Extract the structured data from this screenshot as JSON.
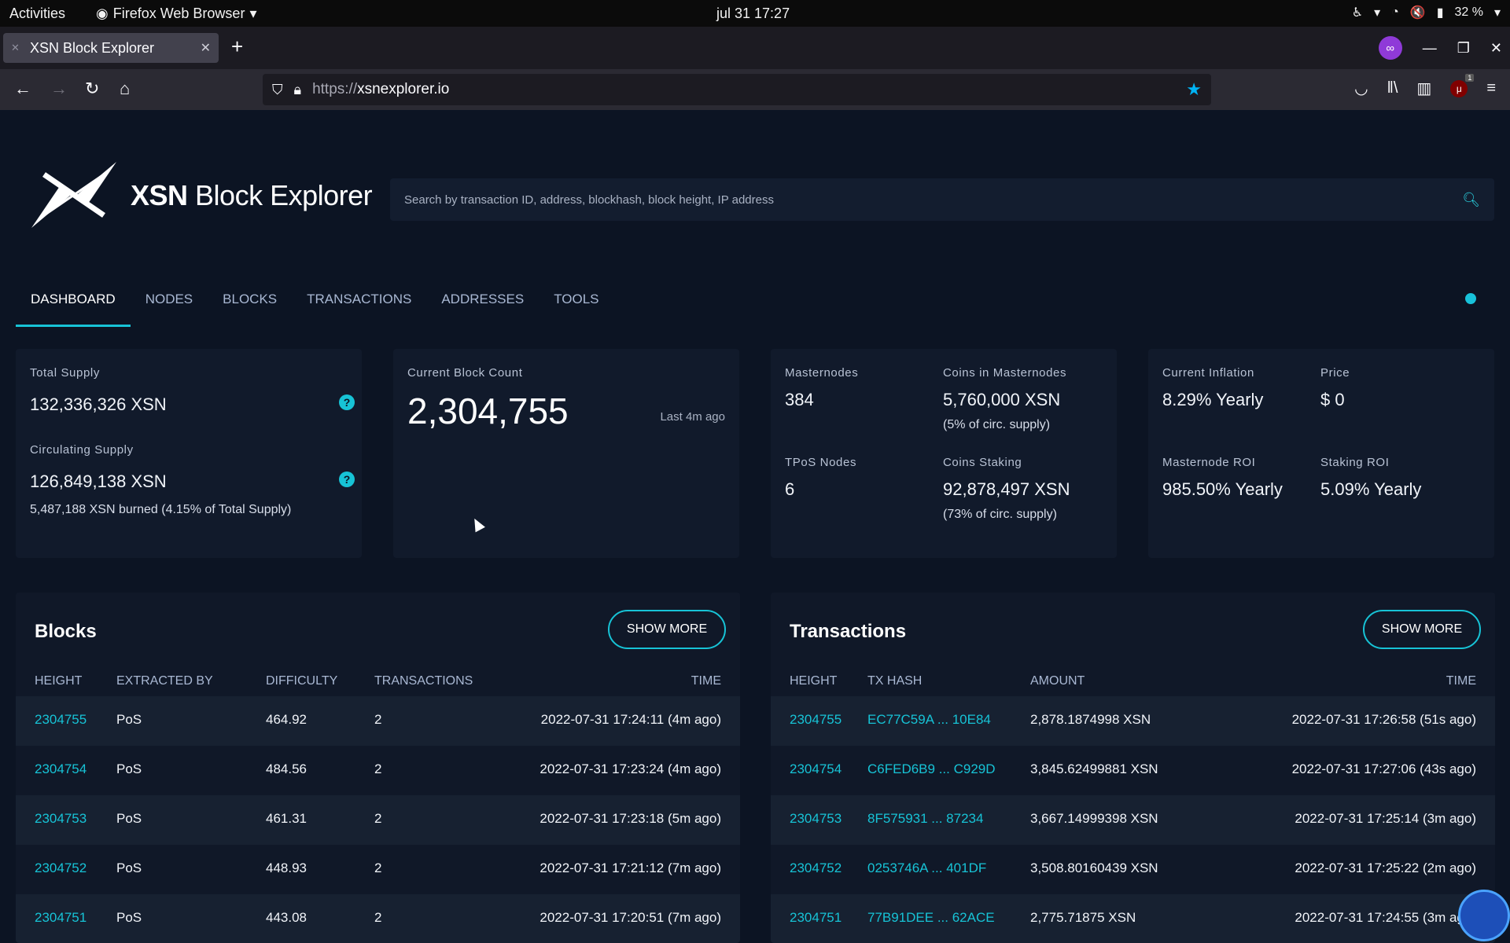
{
  "system": {
    "activities": "Activities",
    "app_name": "Firefox Web Browser",
    "clock": "jul 31  17:27",
    "battery": "32 %"
  },
  "browser": {
    "tab_title": "XSN Block Explorer",
    "url_scheme": "https://",
    "url_host": "xsnexplorer.io",
    "ublock_count": "1"
  },
  "site": {
    "brand_bold": "XSN",
    "brand_rest": " Block Explorer",
    "search_placeholder": "Search by transaction ID, address, blockhash, block height, IP address"
  },
  "nav": {
    "items": [
      "DASHBOARD",
      "NODES",
      "BLOCKS",
      "TRANSACTIONS",
      "ADDRESSES",
      "TOOLS"
    ],
    "active": "DASHBOARD"
  },
  "stats": {
    "total_supply_label": "Total Supply",
    "total_supply": "132,336,326 XSN",
    "circulating_supply_label": "Circulating Supply",
    "circulating_supply": "126,849,138 XSN",
    "burned_note": "5,487,188 XSN burned (4.15% of Total Supply)",
    "block_count_label": "Current Block Count",
    "block_count": "2,304,755",
    "block_count_age": "Last 4m ago",
    "masternodes_label": "Masternodes",
    "masternodes": "384",
    "coins_in_masternodes_label": "Coins in Masternodes",
    "coins_in_masternodes": "5,760,000 XSN",
    "coins_in_masternodes_pct": "(5% of circ. supply)",
    "tpos_label": "TPoS Nodes",
    "tpos": "6",
    "coins_staking_label": "Coins Staking",
    "coins_staking": "92,878,497 XSN",
    "coins_staking_pct": "(73% of circ. supply)",
    "inflation_label": "Current Inflation",
    "inflation": "8.29% Yearly",
    "price_label": "Price",
    "price": "$ 0",
    "mn_roi_label": "Masternode ROI",
    "mn_roi": "985.50% Yearly",
    "staking_roi_label": "Staking ROI",
    "staking_roi": "5.09% Yearly"
  },
  "blocks": {
    "title": "Blocks",
    "show_more": "SHOW MORE",
    "headers": [
      "HEIGHT",
      "EXTRACTED BY",
      "DIFFICULTY",
      "TRANSACTIONS",
      "TIME"
    ],
    "rows": [
      {
        "height": "2304755",
        "by": "PoS",
        "difficulty": "464.92",
        "txs": "2",
        "time": "2022-07-31 17:24:11 (4m ago)"
      },
      {
        "height": "2304754",
        "by": "PoS",
        "difficulty": "484.56",
        "txs": "2",
        "time": "2022-07-31 17:23:24 (4m ago)"
      },
      {
        "height": "2304753",
        "by": "PoS",
        "difficulty": "461.31",
        "txs": "2",
        "time": "2022-07-31 17:23:18 (5m ago)"
      },
      {
        "height": "2304752",
        "by": "PoS",
        "difficulty": "448.93",
        "txs": "2",
        "time": "2022-07-31 17:21:12 (7m ago)"
      },
      {
        "height": "2304751",
        "by": "PoS",
        "difficulty": "443.08",
        "txs": "2",
        "time": "2022-07-31 17:20:51 (7m ago)"
      }
    ]
  },
  "transactions": {
    "title": "Transactions",
    "show_more": "SHOW MORE",
    "headers": [
      "HEIGHT",
      "TX HASH",
      "AMOUNT",
      "TIME"
    ],
    "rows": [
      {
        "height": "2304755",
        "hash": "EC77C59A ... 10E84",
        "amount": "2,878.1874998 XSN",
        "time": "2022-07-31 17:26:58 (51s ago)"
      },
      {
        "height": "2304754",
        "hash": "C6FED6B9 ... C929D",
        "amount": "3,845.62499881 XSN",
        "time": "2022-07-31 17:27:06 (43s ago)"
      },
      {
        "height": "2304753",
        "hash": "8F575931 ... 87234",
        "amount": "3,667.14999398 XSN",
        "time": "2022-07-31 17:25:14 (3m ago)"
      },
      {
        "height": "2304752",
        "hash": "0253746A ... 401DF",
        "amount": "3,508.80160439 XSN",
        "time": "2022-07-31 17:25:22 (2m ago)"
      },
      {
        "height": "2304751",
        "hash": "77B91DEE ... 62ACE",
        "amount": "2,775.71875 XSN",
        "time": "2022-07-31 17:24:55 (3m ago)"
      }
    ]
  },
  "colors": {
    "page_bg": "#0c1423",
    "card_bg": "#111a2b",
    "accent": "#17c3d6"
  }
}
